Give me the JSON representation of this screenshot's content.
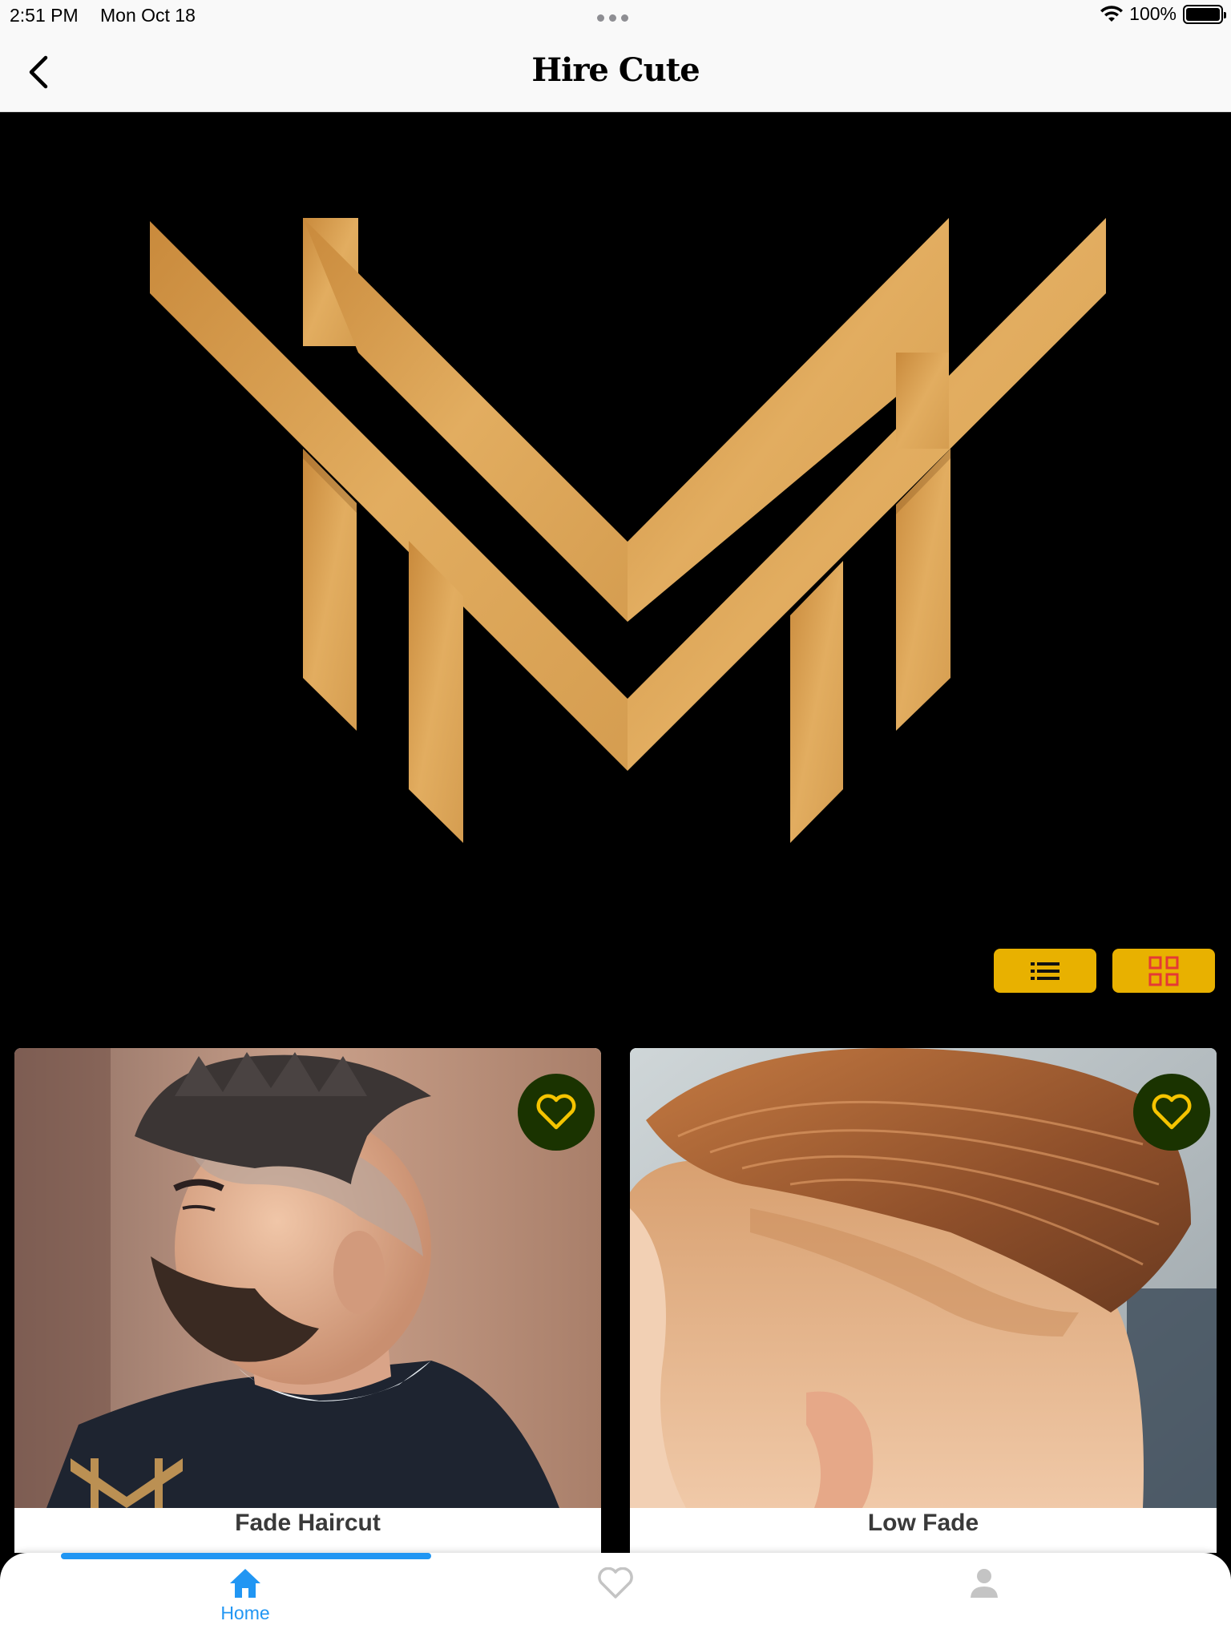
{
  "status_bar": {
    "time": "2:51 PM",
    "date": "Mon Oct 18",
    "battery": "100%"
  },
  "nav": {
    "title": "Hire Cute",
    "back_icon": "chevron-left-icon"
  },
  "banner": {
    "logo_icon": "gold-m-monogram-logo",
    "logo_color": "#e0aa5c"
  },
  "view_toggles": {
    "list_icon": "list-icon",
    "grid_icon": "grid-icon",
    "button_color": "#e8b100",
    "grid_icon_color": "#e53935"
  },
  "cards": [
    {
      "title": "Fade Haircut",
      "favorite_icon": "heart-outline-icon"
    },
    {
      "title": "Low Fade",
      "favorite_icon": "heart-outline-icon"
    }
  ],
  "tab_bar": {
    "tabs": [
      {
        "label": "Home",
        "icon": "home-icon",
        "active": true
      },
      {
        "label": "",
        "icon": "heart-outline-icon",
        "active": false
      },
      {
        "label": "",
        "icon": "person-icon",
        "active": false
      }
    ],
    "accent_color": "#2196f3"
  }
}
